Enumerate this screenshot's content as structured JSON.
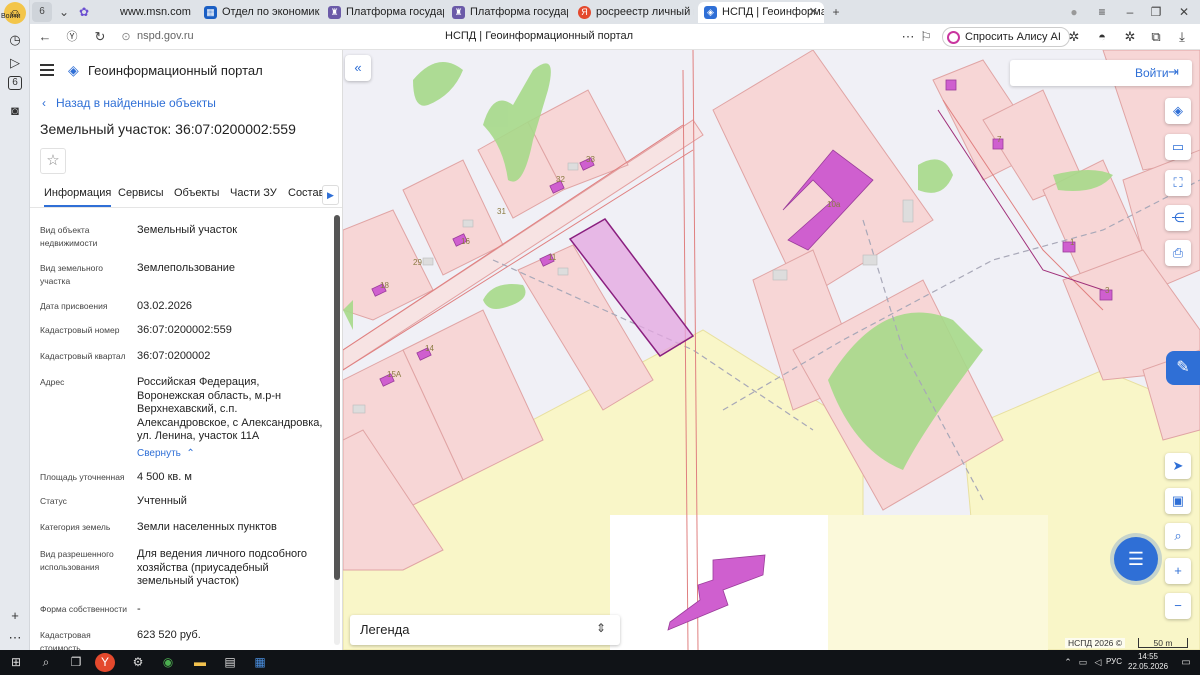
{
  "browser": {
    "tab_counter": "6",
    "tabs": [
      {
        "label": "www.msn.com",
        "fav_color": "#3b7be6",
        "active": false
      },
      {
        "label": "Отдел по экономике и уп",
        "fav_color": "#1b5fc4",
        "active": false
      },
      {
        "label": "Платформа государстве",
        "fav_color": "#6b5aa8",
        "active": false
      },
      {
        "label": "Платформа государстве",
        "fav_color": "#6b5aa8",
        "active": false
      },
      {
        "label": "росреестр личный кабин",
        "fav_color": "#e4492d",
        "active": false
      },
      {
        "label": "НСПД | Геоинформацио",
        "fav_color": "#2f6fd6",
        "active": true
      }
    ],
    "url": "nspd.gov.ru",
    "page_title": "НСПД | Геоинформационный портал",
    "alice_label": "Спросить Алису AI"
  },
  "system_sidebar": {
    "login_label": "Войти",
    "counter": "6"
  },
  "panel": {
    "brand": "Геоинформационный портал",
    "back_link": "Назад в найденные объекты",
    "title": "Земельный участок: 36:07:0200002:559",
    "tabs": [
      "Информация",
      "Сервисы",
      "Объекты",
      "Части ЗУ",
      "Состав"
    ],
    "properties": [
      {
        "key": "Вид объекта недвижимости",
        "value": "Земельный участок"
      },
      {
        "key": "Вид земельного участка",
        "value": "Землепользование"
      },
      {
        "key": "Дата присвоения",
        "value": "03.02.2026"
      },
      {
        "key": "Кадастровый номер",
        "value": "36:07:0200002:559"
      },
      {
        "key": "Кадастровый квартал",
        "value": "36:07:0200002"
      },
      {
        "key": "Адрес",
        "value": "Российская Федерация, Воронежская область, м.р-н Верхнехавский, с.п. Александровское, с Александровка, ул. Ленина, участок 11А"
      },
      {
        "key": "Площадь уточненная",
        "value": "4 500 кв. м"
      },
      {
        "key": "Статус",
        "value": "Учтенный"
      },
      {
        "key": "Категория земель",
        "value": "Земли населенных пунктов"
      },
      {
        "key": "Вид разрешенного использования",
        "value": "Для ведения личного подсобного хозяйства (приусадебный земельный участок)"
      },
      {
        "key": "Форма собственности",
        "value": "-"
      },
      {
        "key": "Кадастровая стоимость",
        "value": "623 520 руб."
      }
    ],
    "collapse_link": "Свернуть"
  },
  "map": {
    "login_label": "Войти",
    "legend_label": "Легенда",
    "attribution": "НСПД 2026 ©",
    "scale_label": "50 m",
    "parcel_numbers": [
      "33",
      "32",
      "31",
      "16",
      "29",
      "11",
      "18",
      "14",
      "15А",
      "10а",
      "7",
      "1",
      "3"
    ]
  },
  "taskbar": {
    "time": "14:55",
    "date": "22.05.2026",
    "lang": "РУС"
  }
}
